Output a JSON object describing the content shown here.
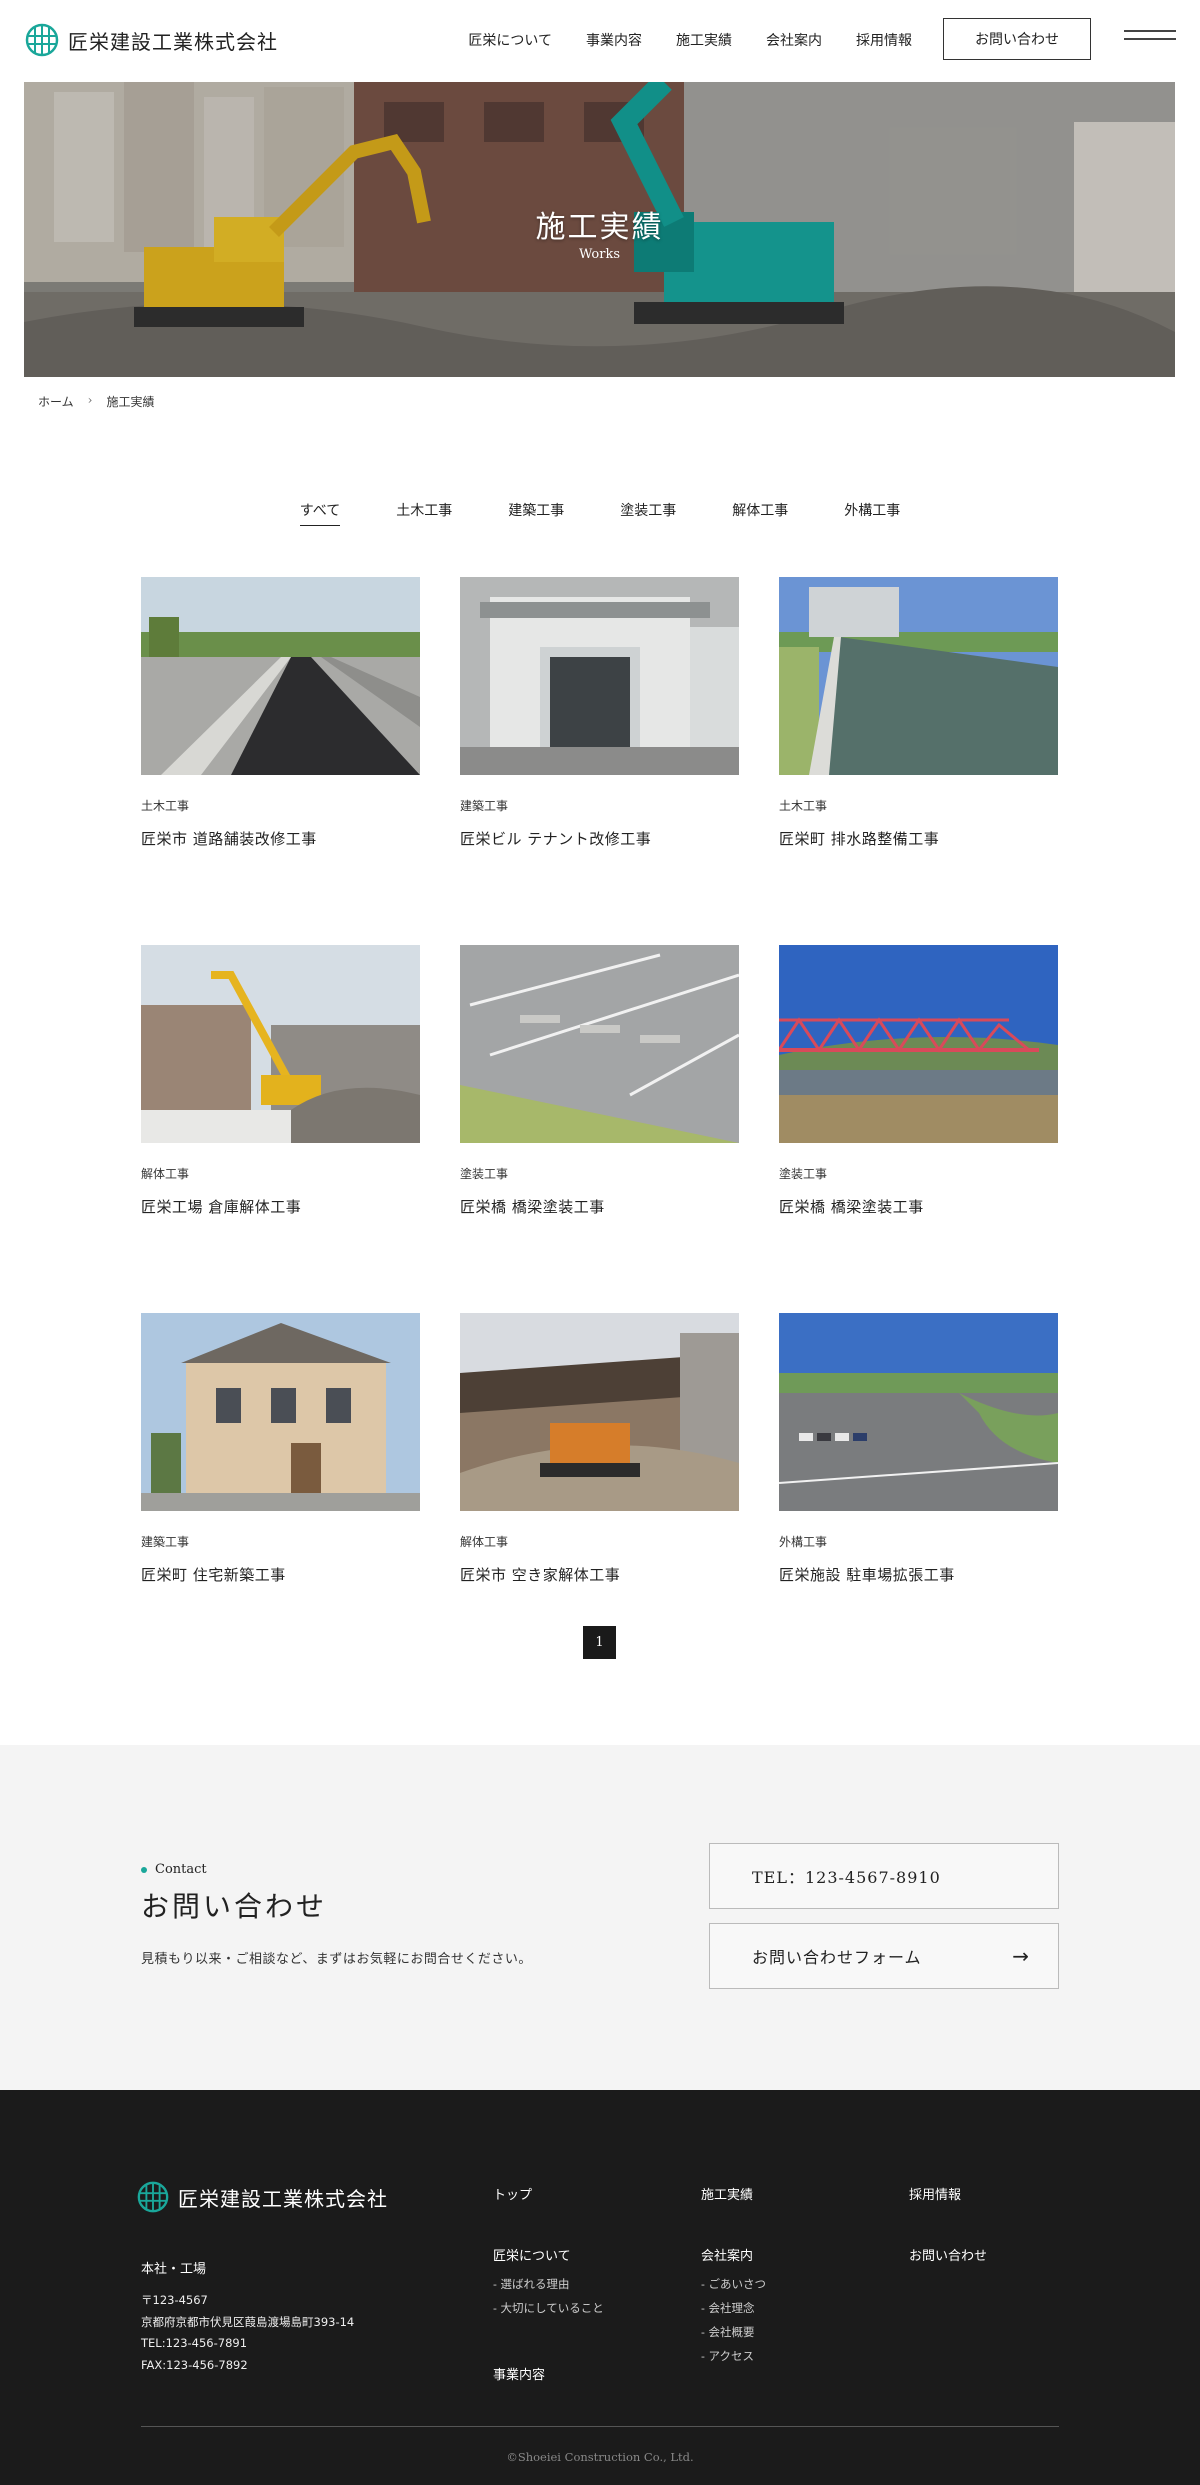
{
  "header": {
    "company": "匠栄建設工業株式会社",
    "nav": [
      "匠栄について",
      "事業内容",
      "施工実績",
      "会社案内",
      "採用情報"
    ],
    "contact_button": "お問い合わせ"
  },
  "hero": {
    "title": "施工実績",
    "subtitle": "Works"
  },
  "breadcrumb": {
    "home": "ホーム",
    "sep": "›",
    "current": "施工実績"
  },
  "filters": [
    "すべて",
    "土木工事",
    "建築工事",
    "塗装工事",
    "解体工事",
    "外構工事"
  ],
  "works": [
    {
      "category": "土木工事",
      "title": "匠栄市 道路舗装改修工事"
    },
    {
      "category": "建築工事",
      "title": "匠栄ビル テナント改修工事"
    },
    {
      "category": "土木工事",
      "title": "匠栄町 排水路整備工事"
    },
    {
      "category": "解体工事",
      "title": "匠栄工場 倉庫解体工事"
    },
    {
      "category": "塗装工事",
      "title": "匠栄橋 橋梁塗装工事"
    },
    {
      "category": "塗装工事",
      "title": "匠栄橋 橋梁塗装工事"
    },
    {
      "category": "建築工事",
      "title": "匠栄町 住宅新築工事"
    },
    {
      "category": "解体工事",
      "title": "匠栄市 空き家解体工事"
    },
    {
      "category": "外構工事",
      "title": "匠栄施設 駐車場拡張工事"
    }
  ],
  "pagination": {
    "current": "1"
  },
  "contact": {
    "label": "Contact",
    "title": "お問い合わせ",
    "description": "見積もり以来・ご相談など、まずはお気軽にお問合せください。",
    "tel": "TEL：123-4567-8910",
    "form_button": "お問い合わせフォーム",
    "arrow": "→"
  },
  "footer": {
    "company": "匠栄建設工業株式会社",
    "office_label": "本社・工場",
    "postal": "〒123-4567",
    "address": "京都府京都市伏見区葭島渡場島町393-14",
    "tel": "TEL:123-456-7891",
    "fax": "FAX:123-456-7892",
    "links": {
      "top": "トップ",
      "about": "匠栄について",
      "about_sub": [
        "- 選ばれる理由",
        "- 大切にしていること"
      ],
      "business": "事業内容",
      "works": "施工実績",
      "company": "会社案内",
      "company_sub": [
        "- ごあいさつ",
        "- 会社理念",
        "- 会社概要",
        "- アクセス"
      ],
      "recruit": "採用情報",
      "contact": "お問い合わせ"
    },
    "copyright": "©Shoeiei Construction Co., Ltd."
  },
  "colors": {
    "accent": "#1aa79a",
    "footer_bg": "#1b1b1b",
    "contact_bg": "#f4f4f4"
  }
}
